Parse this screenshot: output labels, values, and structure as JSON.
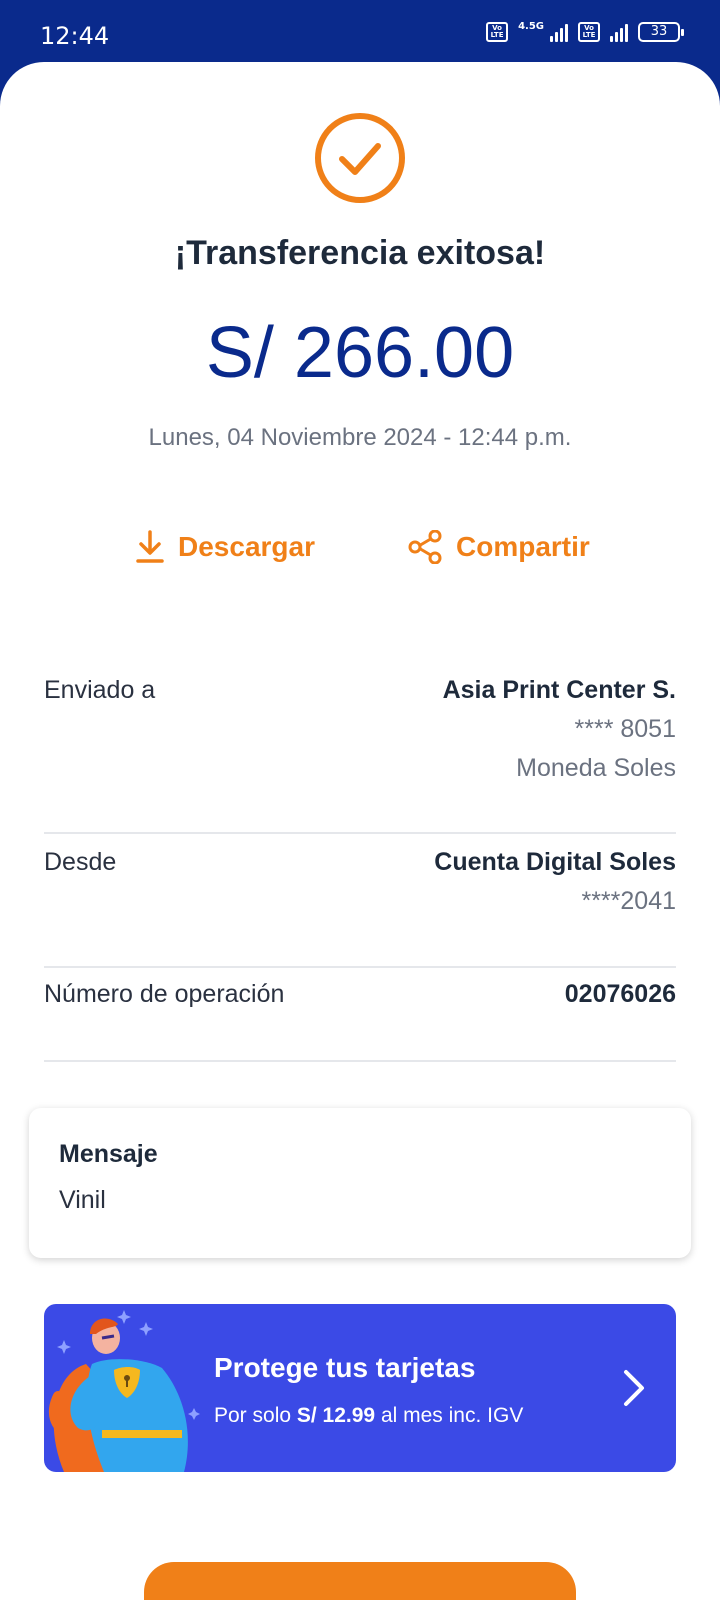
{
  "status_bar": {
    "time": "12:44",
    "network": "4.5G",
    "volte_label": "Vo LTE",
    "battery": "33"
  },
  "receipt": {
    "icon": "check-circle-icon",
    "title": "¡Transferencia exitosa!",
    "amount": "S/ 266.00",
    "datetime": "Lunes, 04 Noviembre 2024 - 12:44 p.m."
  },
  "actions": {
    "download_label": "Descargar",
    "download_icon": "download-icon",
    "share_label": "Compartir",
    "share_icon": "share-icon"
  },
  "details": {
    "sent_to": {
      "label": "Enviado a",
      "name": "Asia Print Center S.",
      "account": "**** 8051",
      "currency": "Moneda Soles"
    },
    "from": {
      "label": "Desde",
      "name": "Cuenta Digital Soles",
      "account": "****2041"
    },
    "operation": {
      "label": "Número de operación",
      "value": "02076026"
    }
  },
  "message": {
    "title": "Mensaje",
    "text": "Vinil"
  },
  "promo": {
    "title": "Protege tus tarjetas",
    "sub_prefix": "Por solo ",
    "sub_price": "S/ 12.99",
    "sub_suffix": " al mes inc. IGV",
    "chevron_icon": "chevron-right-icon",
    "figure": "superhero-illustration"
  },
  "colors": {
    "brand_blue": "#0a2a8c",
    "accent_orange": "#f08018",
    "promo_blue": "#3b4ae6"
  }
}
